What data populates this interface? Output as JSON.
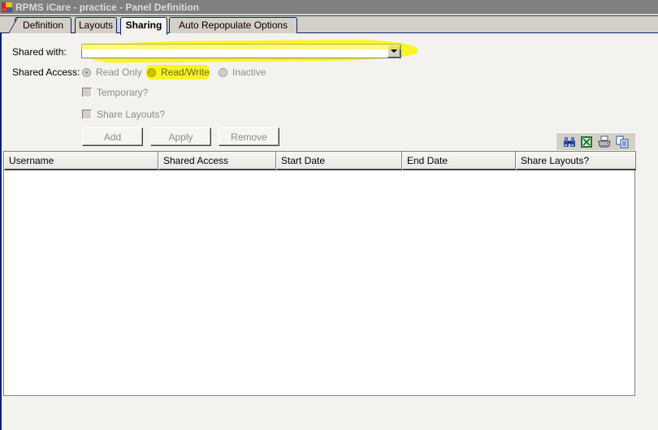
{
  "window": {
    "title": "RPMS iCare - practice - Panel Definition",
    "icon": "app-window-icon"
  },
  "tabs": [
    {
      "label": "Definition",
      "active": false
    },
    {
      "label": "Layouts",
      "active": false
    },
    {
      "label": "Sharing",
      "active": true
    },
    {
      "label": "Auto Repopulate Options",
      "active": false
    }
  ],
  "sharing": {
    "shared_with_label": "Shared with:",
    "shared_with_value": "",
    "shared_access_label": "Shared Access:",
    "access_options": [
      {
        "label": "Read Only",
        "checked": true
      },
      {
        "label": "Read/Write",
        "checked": false
      },
      {
        "label": "Inactive",
        "checked": false
      }
    ],
    "temporary_label": "Temporary?",
    "temporary_checked": false,
    "share_layouts_label": "Share Layouts?",
    "share_layouts_checked": false,
    "buttons": {
      "add": "Add",
      "apply": "Apply",
      "remove": "Remove"
    },
    "annotation_color": "#faf500"
  },
  "toolbar": {
    "icons": [
      "binoculars-find-icon",
      "excel-export-icon",
      "printer-icon",
      "copy-icon"
    ]
  },
  "grid": {
    "columns": [
      "Username",
      "Shared Access",
      "Start Date",
      "End Date",
      "Share Layouts?"
    ],
    "rows": []
  }
}
